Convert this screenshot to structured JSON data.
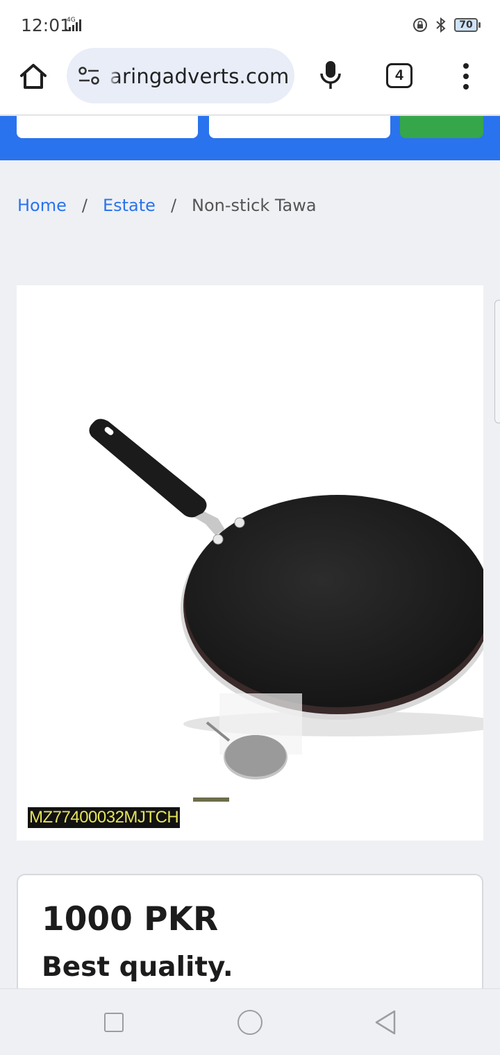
{
  "status_bar": {
    "time": "12:01",
    "network": "4G",
    "battery": "70",
    "icons": [
      "lock-rotation-icon",
      "bluetooth-icon",
      "battery-icon",
      "signal-icon"
    ]
  },
  "browser": {
    "url": "aringadverts.com",
    "tab_count": "4",
    "icons": [
      "home-icon",
      "site-settings-icon",
      "microphone-icon",
      "tabs-icon",
      "more-vert-icon"
    ]
  },
  "breadcrumb": {
    "items": [
      "Home",
      "Estate",
      "Non-stick Tawa"
    ],
    "separator": "/"
  },
  "product": {
    "image_label": "MZ77400032MJTCH",
    "price": "1000 PKR",
    "description": "Best quality."
  },
  "colors": {
    "accent_blue": "#2a73ee",
    "search_green": "#35a64a",
    "label_yellow": "#e6e35a"
  },
  "nav_icons": [
    "recents-square-icon",
    "home-circle-icon",
    "back-triangle-icon"
  ]
}
